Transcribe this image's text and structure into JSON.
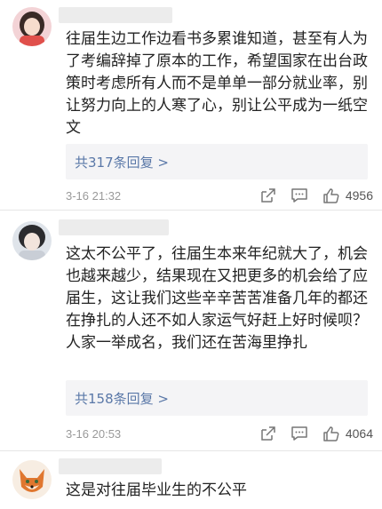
{
  "comments": [
    {
      "text": "往届生边工作边看书多累谁知道，甚至有人为了考编辞掉了原本的工作，希望国家在出台政策时考虑所有人而不是单单一部分就业率，别让努力向上的人寒了心，别让公平成为一纸空文",
      "replies_label": "共317条回复 >",
      "time": "3-16 21:32",
      "likes": "4956",
      "avatar_icon": "avatar-girl-icon"
    },
    {
      "text": "这太不公平了，往届生本来年纪就大了，机会也越来越少，结果现在又把更多的机会给了应届生，这让我们这些辛辛苦苦准备几年的都还在挣扎的人还不如人家运气好赶上好时候呗？人家一举成名，我们还在苦海里挣扎",
      "replies_label": "共158条回复 >",
      "time": "3-16 20:53",
      "likes": "4064",
      "avatar_icon": "avatar-girl-icon"
    },
    {
      "text": "这是对往届毕业生的不公平",
      "avatar_icon": "avatar-fox-icon"
    }
  ],
  "colors": {
    "reply_link": "#5a78a8",
    "reply_bg": "#f4f4f6",
    "meta_text": "#999999"
  },
  "icons": {
    "share": "share-icon",
    "comment": "comment-icon",
    "like": "thumbs-up-icon"
  }
}
